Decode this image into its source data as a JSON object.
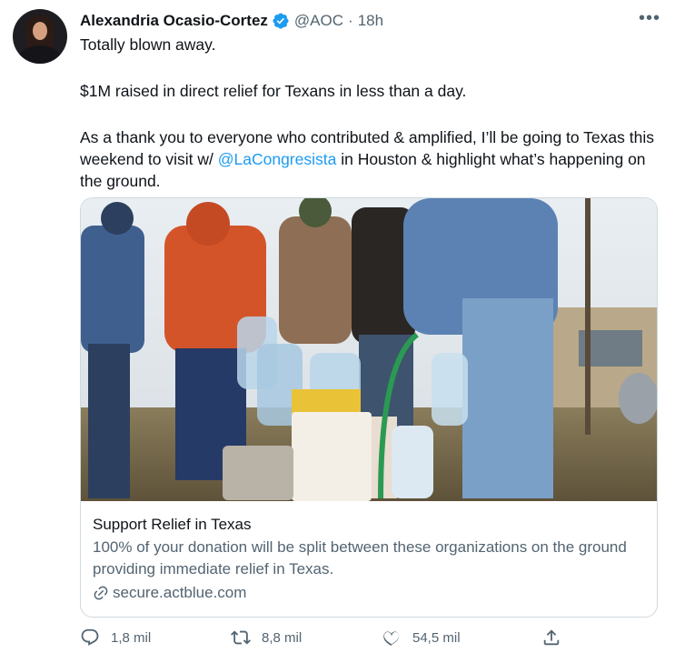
{
  "author": {
    "name": "Alexandria Ocasio-Cortez",
    "handle": "@AOC",
    "separator": "·",
    "time": "18h"
  },
  "tweet": {
    "line1": "Totally blown away.",
    "line2": "$1M raised in direct relief for Texans in less than a day.",
    "line3_a": "As a thank you to everyone who contributed & amplified, I’ll be going to Texas this weekend to visit w/ ",
    "mention": "@LaCongresista",
    "line3_b": " in Houston & highlight what’s happening on the ground."
  },
  "card": {
    "title": "Support Relief in Texas",
    "description": "100% of your donation will be split between these organizations on the ground providing immediate relief in Texas.",
    "domain": "secure.actblue.com",
    "image_icon": "photo-people-filling-water-jugs"
  },
  "actions": {
    "reply_count": "1,8 mil",
    "retweet_count": "8,8 mil",
    "like_count": "54,5 mil"
  },
  "colors": {
    "link": "#1d9bf0",
    "secondary": "#536471",
    "verified": "#1d9bf0"
  }
}
